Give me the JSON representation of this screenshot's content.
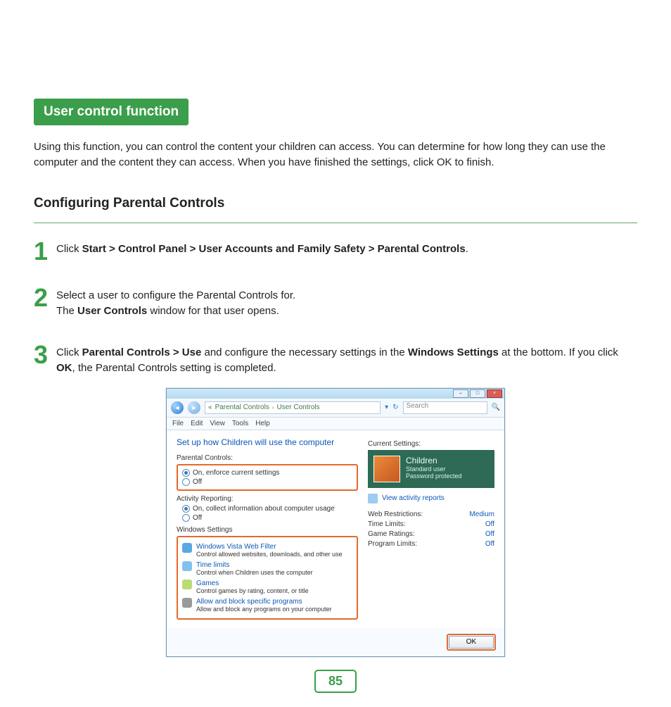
{
  "section_title": "User control function",
  "intro": "Using this function, you can control the content your children can access. You can determine for how long they can use the computer and the content they can access. When you have finished the settings, click OK to finish.",
  "sub_heading": "Configuring Parental Controls",
  "steps": {
    "s1": {
      "num": "1",
      "pre": "Click ",
      "bold": "Start > Control Panel > User Accounts and Family Safety > Parental Controls",
      "post": "."
    },
    "s2": {
      "num": "2",
      "line1": "Select a user to configure the Parental Controls for.",
      "line2_pre": "The ",
      "line2_bold": "User Controls",
      "line2_post": " window for that user opens."
    },
    "s3": {
      "num": "3",
      "p1": "Click ",
      "b1": "Parental Controls > Use",
      "p2": " and configure the necessary settings in the ",
      "b2": "Windows Settings",
      "p3": " at the bottom. If you click ",
      "b3": "OK",
      "p4": ", the Parental Controls setting is completed."
    }
  },
  "screenshot": {
    "window_controls": {
      "min": "–",
      "max": "□",
      "close": "×"
    },
    "breadcrumb": {
      "prefix": "«",
      "a": "Parental Controls",
      "sep": "›",
      "b": "User Controls"
    },
    "search_placeholder": "Search",
    "menu": [
      "File",
      "Edit",
      "View",
      "Tools",
      "Help"
    ],
    "heading": "Set up how Children will use the computer",
    "parental_label": "Parental Controls:",
    "radio_on": "On, enforce current settings",
    "radio_off": "Off",
    "activity_label": "Activity Reporting:",
    "activity_on": "On, collect information about computer usage",
    "activity_off": "Off",
    "ws_label": "Windows Settings",
    "ws": [
      {
        "title": "Windows Vista Web Filter",
        "desc": "Control allowed websites, downloads, and other use",
        "color": "#5aa8e0"
      },
      {
        "title": "Time limits",
        "desc": "Control when Children uses the computer",
        "color": "#81c2ed"
      },
      {
        "title": "Games",
        "desc": "Control games by rating, content, or title",
        "color": "#b9dd73"
      },
      {
        "title": "Allow and block specific programs",
        "desc": "Allow and block any programs on your computer",
        "color": "#999"
      }
    ],
    "right": {
      "current_label": "Current Settings:",
      "user_name": "Children",
      "user_role": "Standard user",
      "user_pw": "Password protected",
      "view_reports": "View activity reports",
      "rows": [
        {
          "k": "Web Restrictions:",
          "v": "Medium"
        },
        {
          "k": "Time Limits:",
          "v": "Off"
        },
        {
          "k": "Game Ratings:",
          "v": "Off"
        },
        {
          "k": "Program Limits:",
          "v": "Off"
        }
      ]
    },
    "ok": "OK"
  },
  "page_number": "85"
}
